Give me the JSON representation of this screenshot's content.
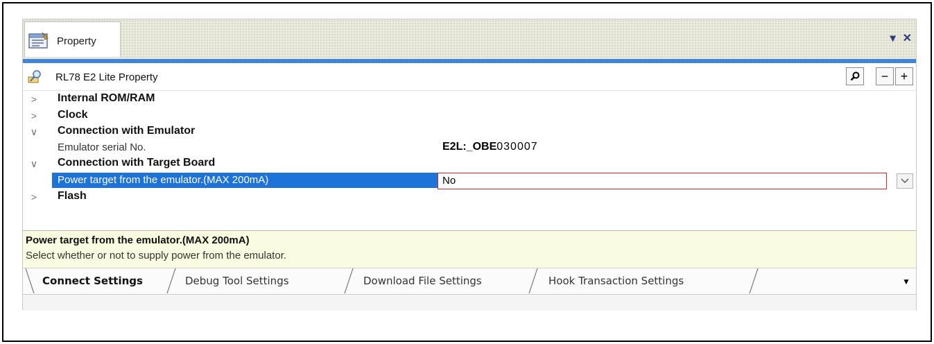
{
  "window": {
    "tab_label": "Property",
    "icon": "property-window-icon",
    "pin_icon": "dropdown-pin-icon",
    "close_icon": "close-icon"
  },
  "header": {
    "title": "RL78 E2 Lite Property",
    "icon": "property-search-icon",
    "search_icon": "magnifier-icon",
    "collapse_label": "−",
    "expand_label": "+"
  },
  "grid": {
    "rows": [
      {
        "type": "category",
        "label": "Internal ROM/RAM",
        "expanded": false,
        "chevron": ">"
      },
      {
        "type": "category",
        "label": "Clock",
        "expanded": false,
        "chevron": ">"
      },
      {
        "type": "category",
        "label": "Connection with Emulator",
        "expanded": true,
        "chevron": "∨"
      },
      {
        "type": "property",
        "label": "Emulator serial No.",
        "value_bold": "E2L:_OBE",
        "value_rest": "030007"
      },
      {
        "type": "category",
        "label": "Connection with Target Board",
        "expanded": true,
        "chevron": "∨"
      },
      {
        "type": "property",
        "label": "Power target from the emulator.(MAX 200mA)",
        "value": "No",
        "selected": true,
        "dropdown_icon": "chevron-down-icon"
      },
      {
        "type": "category",
        "label": "Flash",
        "expanded": false,
        "chevron": ">"
      }
    ]
  },
  "description": {
    "title": "Power target from the emulator.(MAX 200mA)",
    "text": "Select whether or not to supply power from the emulator."
  },
  "tabs": [
    {
      "label": "Connect Settings",
      "active": true
    },
    {
      "label": "Debug Tool Settings",
      "active": false
    },
    {
      "label": "Download File Settings",
      "active": false
    },
    {
      "label": "Hook Transaction Settings",
      "active": false
    }
  ],
  "tab_menu_icon": "triangle-down-icon",
  "colors": {
    "accent_blue": "#3f84db",
    "selection_blue": "#1e73d8",
    "highlight_red": "#d92424",
    "description_bg": "#fbfbe1"
  }
}
